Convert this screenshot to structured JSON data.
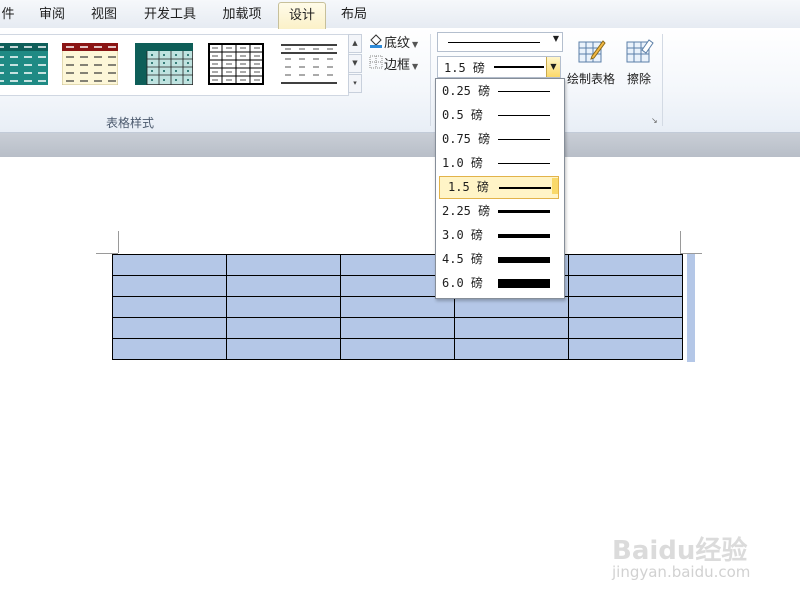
{
  "tabs": [
    {
      "label": "件",
      "active": false
    },
    {
      "label": "审阅",
      "active": false
    },
    {
      "label": "视图",
      "active": false
    },
    {
      "label": "开发工具",
      "active": false
    },
    {
      "label": "加载项",
      "active": false
    },
    {
      "label": "设计",
      "active": true
    },
    {
      "label": "布局",
      "active": false
    }
  ],
  "ribbon": {
    "table_styles_label": "表格样式",
    "shading_label": "底纹",
    "borders_label": "边框",
    "line_weight_value": "1.5 磅",
    "draw_table_label": "绘制表格",
    "eraser_label": "擦除"
  },
  "dropdown": {
    "options": [
      {
        "label": "0.25 磅",
        "weight_pt": 0.25,
        "selected": false
      },
      {
        "label": "0.5 磅",
        "weight_pt": 0.5,
        "selected": false
      },
      {
        "label": "0.75 磅",
        "weight_pt": 0.75,
        "selected": false
      },
      {
        "label": "1.0 磅",
        "weight_pt": 1.0,
        "selected": false
      },
      {
        "label": "1.5 磅",
        "weight_pt": 1.5,
        "selected": true
      },
      {
        "label": "2.25 磅",
        "weight_pt": 2.25,
        "selected": false
      },
      {
        "label": "3.0 磅",
        "weight_pt": 3.0,
        "selected": false
      },
      {
        "label": "4.5 磅",
        "weight_pt": 4.5,
        "selected": false
      },
      {
        "label": "6.0 磅",
        "weight_pt": 6.0,
        "selected": false
      }
    ]
  },
  "document": {
    "table_rows": 5,
    "table_cols": 5,
    "cell_color": "#b4c7e7"
  },
  "watermark": {
    "logo_text": "Baidu经验",
    "url": "jingyan.baidu.com"
  },
  "colors": {
    "active_tab": "#fbf1c8",
    "selection_highlight": "#fff4c7",
    "table_fill": "#b4c7e7"
  }
}
